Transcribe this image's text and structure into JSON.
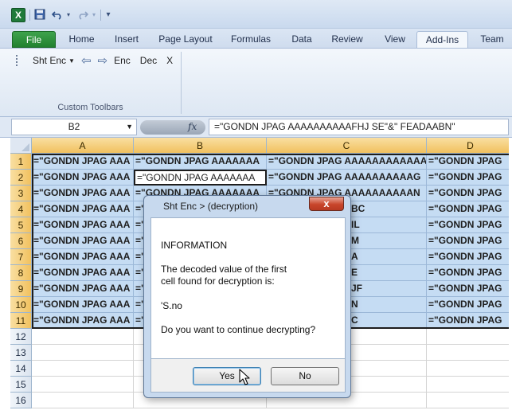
{
  "qat": {
    "logo_letter": "X",
    "icons": [
      "excel-logo-icon",
      "save-icon",
      "undo-icon",
      "redo-icon",
      "customize-qat-icon"
    ]
  },
  "tabs": [
    "File",
    "Home",
    "Insert",
    "Page Layout",
    "Formulas",
    "Data",
    "Review",
    "View",
    "Add-Ins",
    "Team"
  ],
  "active_tab": "Add-Ins",
  "ribbon": {
    "toolbar": {
      "sheet_dropdown": "Sht Enc",
      "enc": "Enc",
      "dec": "Dec",
      "close": "X"
    },
    "group_label": "Custom Toolbars"
  },
  "formula_bar": {
    "name_box": "B2",
    "fx": "fx",
    "formula": "=\"GONDN JPAG AAAAAAAAAAFHJ SE\"&\" FEADAABN\""
  },
  "grid": {
    "columns": [
      "A",
      "B",
      "C",
      "D"
    ],
    "rows": [
      "1",
      "2",
      "3",
      "4",
      "5",
      "6",
      "7",
      "8",
      "9",
      "10",
      "11",
      "12",
      "13",
      "14",
      "15",
      "16"
    ],
    "cells": {
      "A": [
        "=\"GONDN JPAG AAA",
        "=\"GONDN JPAG AAA",
        "=\"GONDN JPAG AAA",
        "=\"GONDN JPAG AAA",
        "=\"GONDN JPAG AAA",
        "=\"GONDN JPAG AAA",
        "=\"GONDN JPAG AAA",
        "=\"GONDN JPAG AAA",
        "=\"GONDN JPAG AAA",
        "=\"GONDN JPAG AAA",
        "=\"GONDN JPAG AAA"
      ],
      "B": [
        "=\"GONDN JPAG AAAAAAA",
        "=\"GONDN JPAG AAAAAAA",
        "=\"GONDN JPAG AAAAAAA",
        "=\"GONDN JPAG",
        "=\"GONDN JPAG",
        "=\"GONDN JPAG",
        "=\"GONDN JPAG",
        "=\"GONDN JPAG",
        "=\"GONDN JPAG",
        "=\"GONDN JPAG",
        "=\"GONDN JPAG"
      ],
      "C": [
        "=\"GONDN JPAG AAAAAAAAAAAAC",
        "=\"GONDN JPAG AAAAAAAAAAG",
        "=\"GONDN JPAG AAAAAAAAAAN",
        "AAAAAAAAAAAABC",
        "AAAAAAAAAAABIL",
        "AAAAAAAAAAABM",
        "AAAAAAAAAAACA",
        "AAAAAAAAAAACE",
        "AAAAAAAAAAACJF",
        "AAAAAAAAAAACN",
        "AAAAAAAAAAADC"
      ],
      "D": [
        "=\"GONDN JPAG",
        "=\"GONDN JPAG",
        "=\"GONDN JPAG",
        "=\"GONDN JPAG",
        "=\"GONDN JPAG",
        "=\"GONDN JPAG",
        "=\"GONDN JPAG",
        "=\"GONDN JPAG",
        "=\"GONDN JPAG",
        "=\"GONDN JPAG",
        "=\"GONDN JPAG"
      ]
    }
  },
  "dialog": {
    "title": "Sht Enc > (decryption)",
    "close": "x",
    "heading": "INFORMATION",
    "line1": "The decoded value of the first",
    "line2": "cell found for decryption is:",
    "value": "'S.no",
    "question": "Do you want to continue decrypting?",
    "yes": "Yes",
    "no": "No"
  },
  "colors": {
    "file_tab": "#21812f",
    "selection": "#c5dcf3",
    "header_selected": "#f1c15f"
  }
}
